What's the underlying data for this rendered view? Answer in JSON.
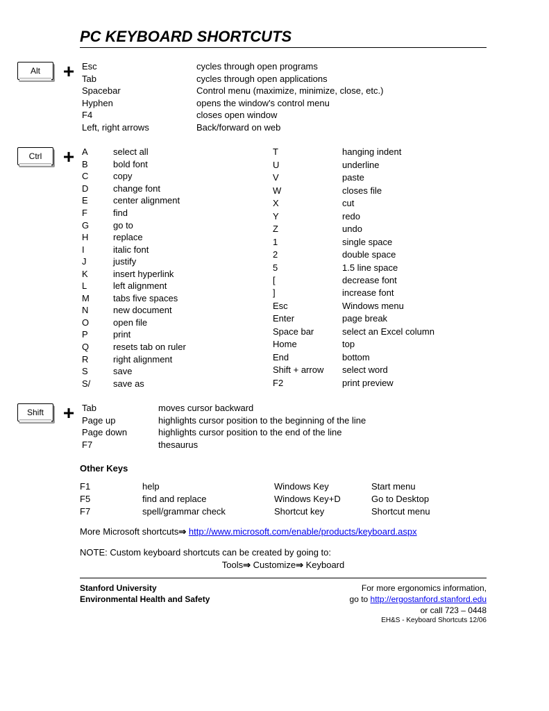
{
  "title": "PC KEYBOARD SHORTCUTS",
  "keys": {
    "alt": "Alt",
    "ctrl": "Ctrl",
    "shift": "Shift"
  },
  "alt": [
    [
      "Esc",
      "cycles through open programs"
    ],
    [
      "Tab",
      "cycles through open applications"
    ],
    [
      "Spacebar",
      "Control menu (maximize, minimize, close, etc.)"
    ],
    [
      "Hyphen",
      "opens the window's control menu"
    ],
    [
      "F4",
      "closes open window"
    ],
    [
      "Left, right arrows",
      "Back/forward on web"
    ]
  ],
  "ctrl_left": [
    [
      "A",
      "select all"
    ],
    [
      "B",
      "bold font"
    ],
    [
      "C",
      "copy"
    ],
    [
      "D",
      "change font"
    ],
    [
      "E",
      "center alignment"
    ],
    [
      "F",
      "find"
    ],
    [
      "G",
      "go to"
    ],
    [
      "H",
      "replace"
    ],
    [
      "I",
      "italic font"
    ],
    [
      "J",
      "justify"
    ],
    [
      "K",
      "insert hyperlink"
    ],
    [
      "L",
      "left alignment"
    ],
    [
      "M",
      "tabs five spaces"
    ],
    [
      "N",
      "new document"
    ],
    [
      "O",
      "open file"
    ],
    [
      "P",
      "print"
    ],
    [
      "Q",
      "resets tab on ruler"
    ],
    [
      "R",
      "right alignment"
    ],
    [
      "S",
      "save"
    ],
    [
      "S/",
      "save as"
    ]
  ],
  "ctrl_right": [
    [
      "T",
      "hanging indent"
    ],
    [
      "U",
      "underline"
    ],
    [
      "V",
      "paste"
    ],
    [
      "W",
      "closes file"
    ],
    [
      "X",
      "cut"
    ],
    [
      "Y",
      "redo"
    ],
    [
      "Z",
      "undo"
    ],
    [
      "1",
      "single space"
    ],
    [
      "2",
      "double space"
    ],
    [
      "5",
      "1.5 line space"
    ],
    [
      "[",
      "decrease font"
    ],
    [
      "]",
      "increase font"
    ],
    [
      "Esc",
      "Windows menu"
    ],
    [
      "Enter",
      "page break"
    ],
    [
      "Space bar",
      "select an Excel column"
    ],
    [
      "Home",
      "top"
    ],
    [
      "End",
      "bottom"
    ],
    [
      "Shift + arrow",
      "select word"
    ],
    [
      "F2",
      "print preview"
    ]
  ],
  "shift": [
    [
      "Tab",
      "moves cursor backward"
    ],
    [
      "Page up",
      "highlights cursor position to the beginning of the line"
    ],
    [
      "Page down",
      "highlights cursor position to the end of the line"
    ],
    [
      "F7",
      "thesaurus"
    ]
  ],
  "other_head": "Other Keys",
  "other": [
    [
      "F1",
      "help",
      "Windows Key",
      "Start menu"
    ],
    [
      "F5",
      "find and replace",
      "Windows Key+D",
      "Go to Desktop"
    ],
    [
      "F7",
      "spell/grammar check",
      "Shortcut key",
      "Shortcut menu"
    ]
  ],
  "more_text": "More Microsoft shortcuts",
  "more_link": "http://www.microsoft.com/enable/products/keyboard.aspx",
  "note1": "NOTE: Custom keyboard shortcuts can be created by going to:",
  "note2a": "Tools",
  "note2b": " Customize",
  "note2c": " Keyboard",
  "footer": {
    "org1": "Stanford University",
    "org2": "Environmental Health and Safety",
    "info": "For more ergonomics information,",
    "goto": "go to ",
    "link": "http://ergostanford.stanford.edu",
    "call": "or call 723 – 0448",
    "tiny": "EH&S - Keyboard Shortcuts 12/06"
  }
}
